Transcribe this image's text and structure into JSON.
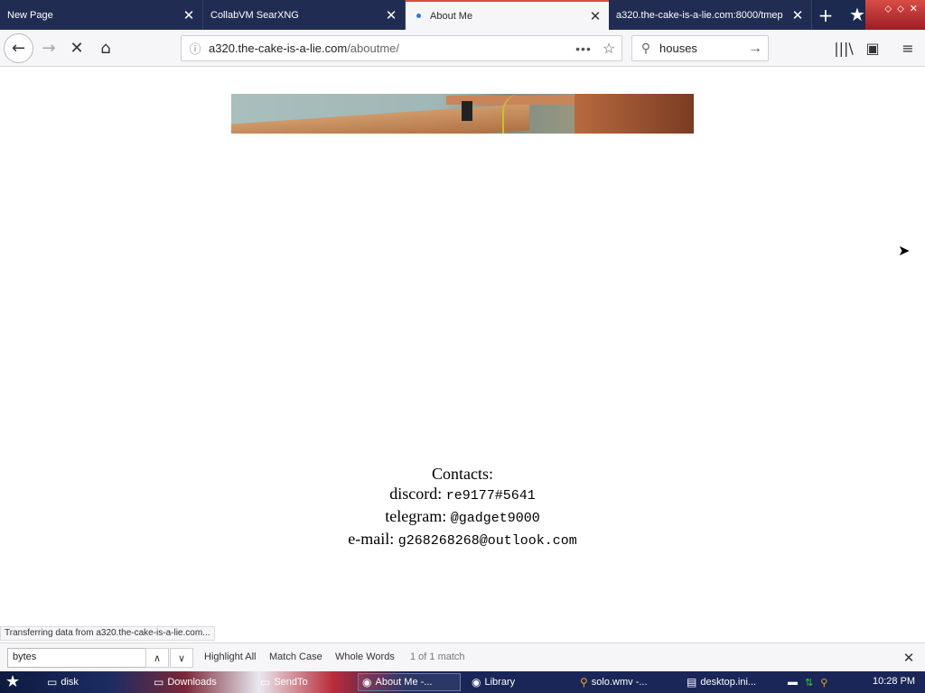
{
  "tabs": [
    {
      "label": "New Page"
    },
    {
      "label": "CollabVM SearXNG"
    },
    {
      "label": "About Me"
    },
    {
      "label": "a320.the-cake-is-a-lie.com:8000/tmep"
    }
  ],
  "toolbar": {
    "newtab_glyph": "+",
    "back_glyph": "←",
    "forward_glyph": "→",
    "stop_glyph": "✕",
    "home_glyph": "⌂",
    "library_glyph": "|||\\",
    "sidebar_glyph": "▣",
    "menu_glyph": "≡"
  },
  "urlbar": {
    "info_glyph": "ⓘ",
    "host": "a320.the-cake-is-a-lie.com",
    "path": "/aboutme/",
    "more_glyph": "•••",
    "star_glyph": "☆"
  },
  "searchbar": {
    "value": "houses",
    "icon": "search-icon",
    "go_glyph": "→"
  },
  "page": {
    "contacts_heading": "Contacts:",
    "discord_label": "discord:",
    "discord_value": "re9177#5641",
    "telegram_label": "telegram:",
    "telegram_value": "@gadget9000",
    "email_label": "e-mail:",
    "email_value": "g268268268@outlook.com"
  },
  "status_text": "Transferring data from a320.the-cake-is-a-lie.com...",
  "findbar": {
    "query": "bytes",
    "prev_glyph": "∧",
    "next_glyph": "∨",
    "highlight_all": "Highlight All",
    "match_case": "Match Case",
    "whole_words": "Whole Words",
    "status": "1 of 1 match",
    "close_glyph": "✕"
  },
  "taskbar": {
    "start_glyph": "★",
    "items": [
      {
        "label": "disk",
        "icon": "folder-icon"
      },
      {
        "label": "Downloads",
        "icon": "folder-icon"
      },
      {
        "label": "SendTo",
        "icon": "folder-icon"
      },
      {
        "label": "About Me -...",
        "icon": "browser-icon"
      },
      {
        "label": "Library",
        "icon": "browser-icon"
      },
      {
        "label": "solo.wmv -...",
        "icon": "search-icon"
      },
      {
        "label": "desktop.ini...",
        "icon": "document-icon"
      }
    ],
    "clock": "10:28 PM"
  }
}
